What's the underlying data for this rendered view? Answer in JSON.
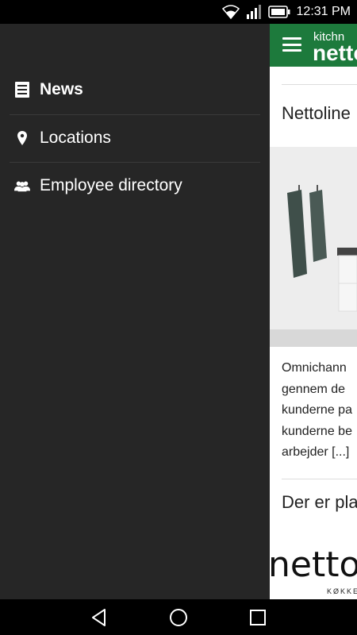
{
  "status_bar": {
    "time": "12:31 PM",
    "icons": [
      "wifi-icon",
      "signal-icon",
      "battery-icon"
    ]
  },
  "drawer": {
    "items": [
      {
        "label": "News",
        "icon": "news-icon",
        "active": true
      },
      {
        "label": "Locations",
        "icon": "location-pin-icon",
        "active": false
      },
      {
        "label": "Employee directory",
        "icon": "people-icon",
        "active": false
      }
    ]
  },
  "app_bar": {
    "logo_small": "kitchn",
    "logo_big": "netto",
    "color": "#1d7a3c"
  },
  "feed": {
    "article1_title": "Nettoline",
    "excerpt_lines": [
      "Omnichann",
      "gennem de",
      "kunderne pa",
      "kunderne be",
      "arbejder [...]"
    ],
    "article2_title": "Der er pla",
    "brand_text": "netto",
    "brand_sub": "KØKKE"
  },
  "nav_bar": {
    "buttons": [
      "back-icon",
      "home-icon",
      "recents-icon"
    ]
  }
}
